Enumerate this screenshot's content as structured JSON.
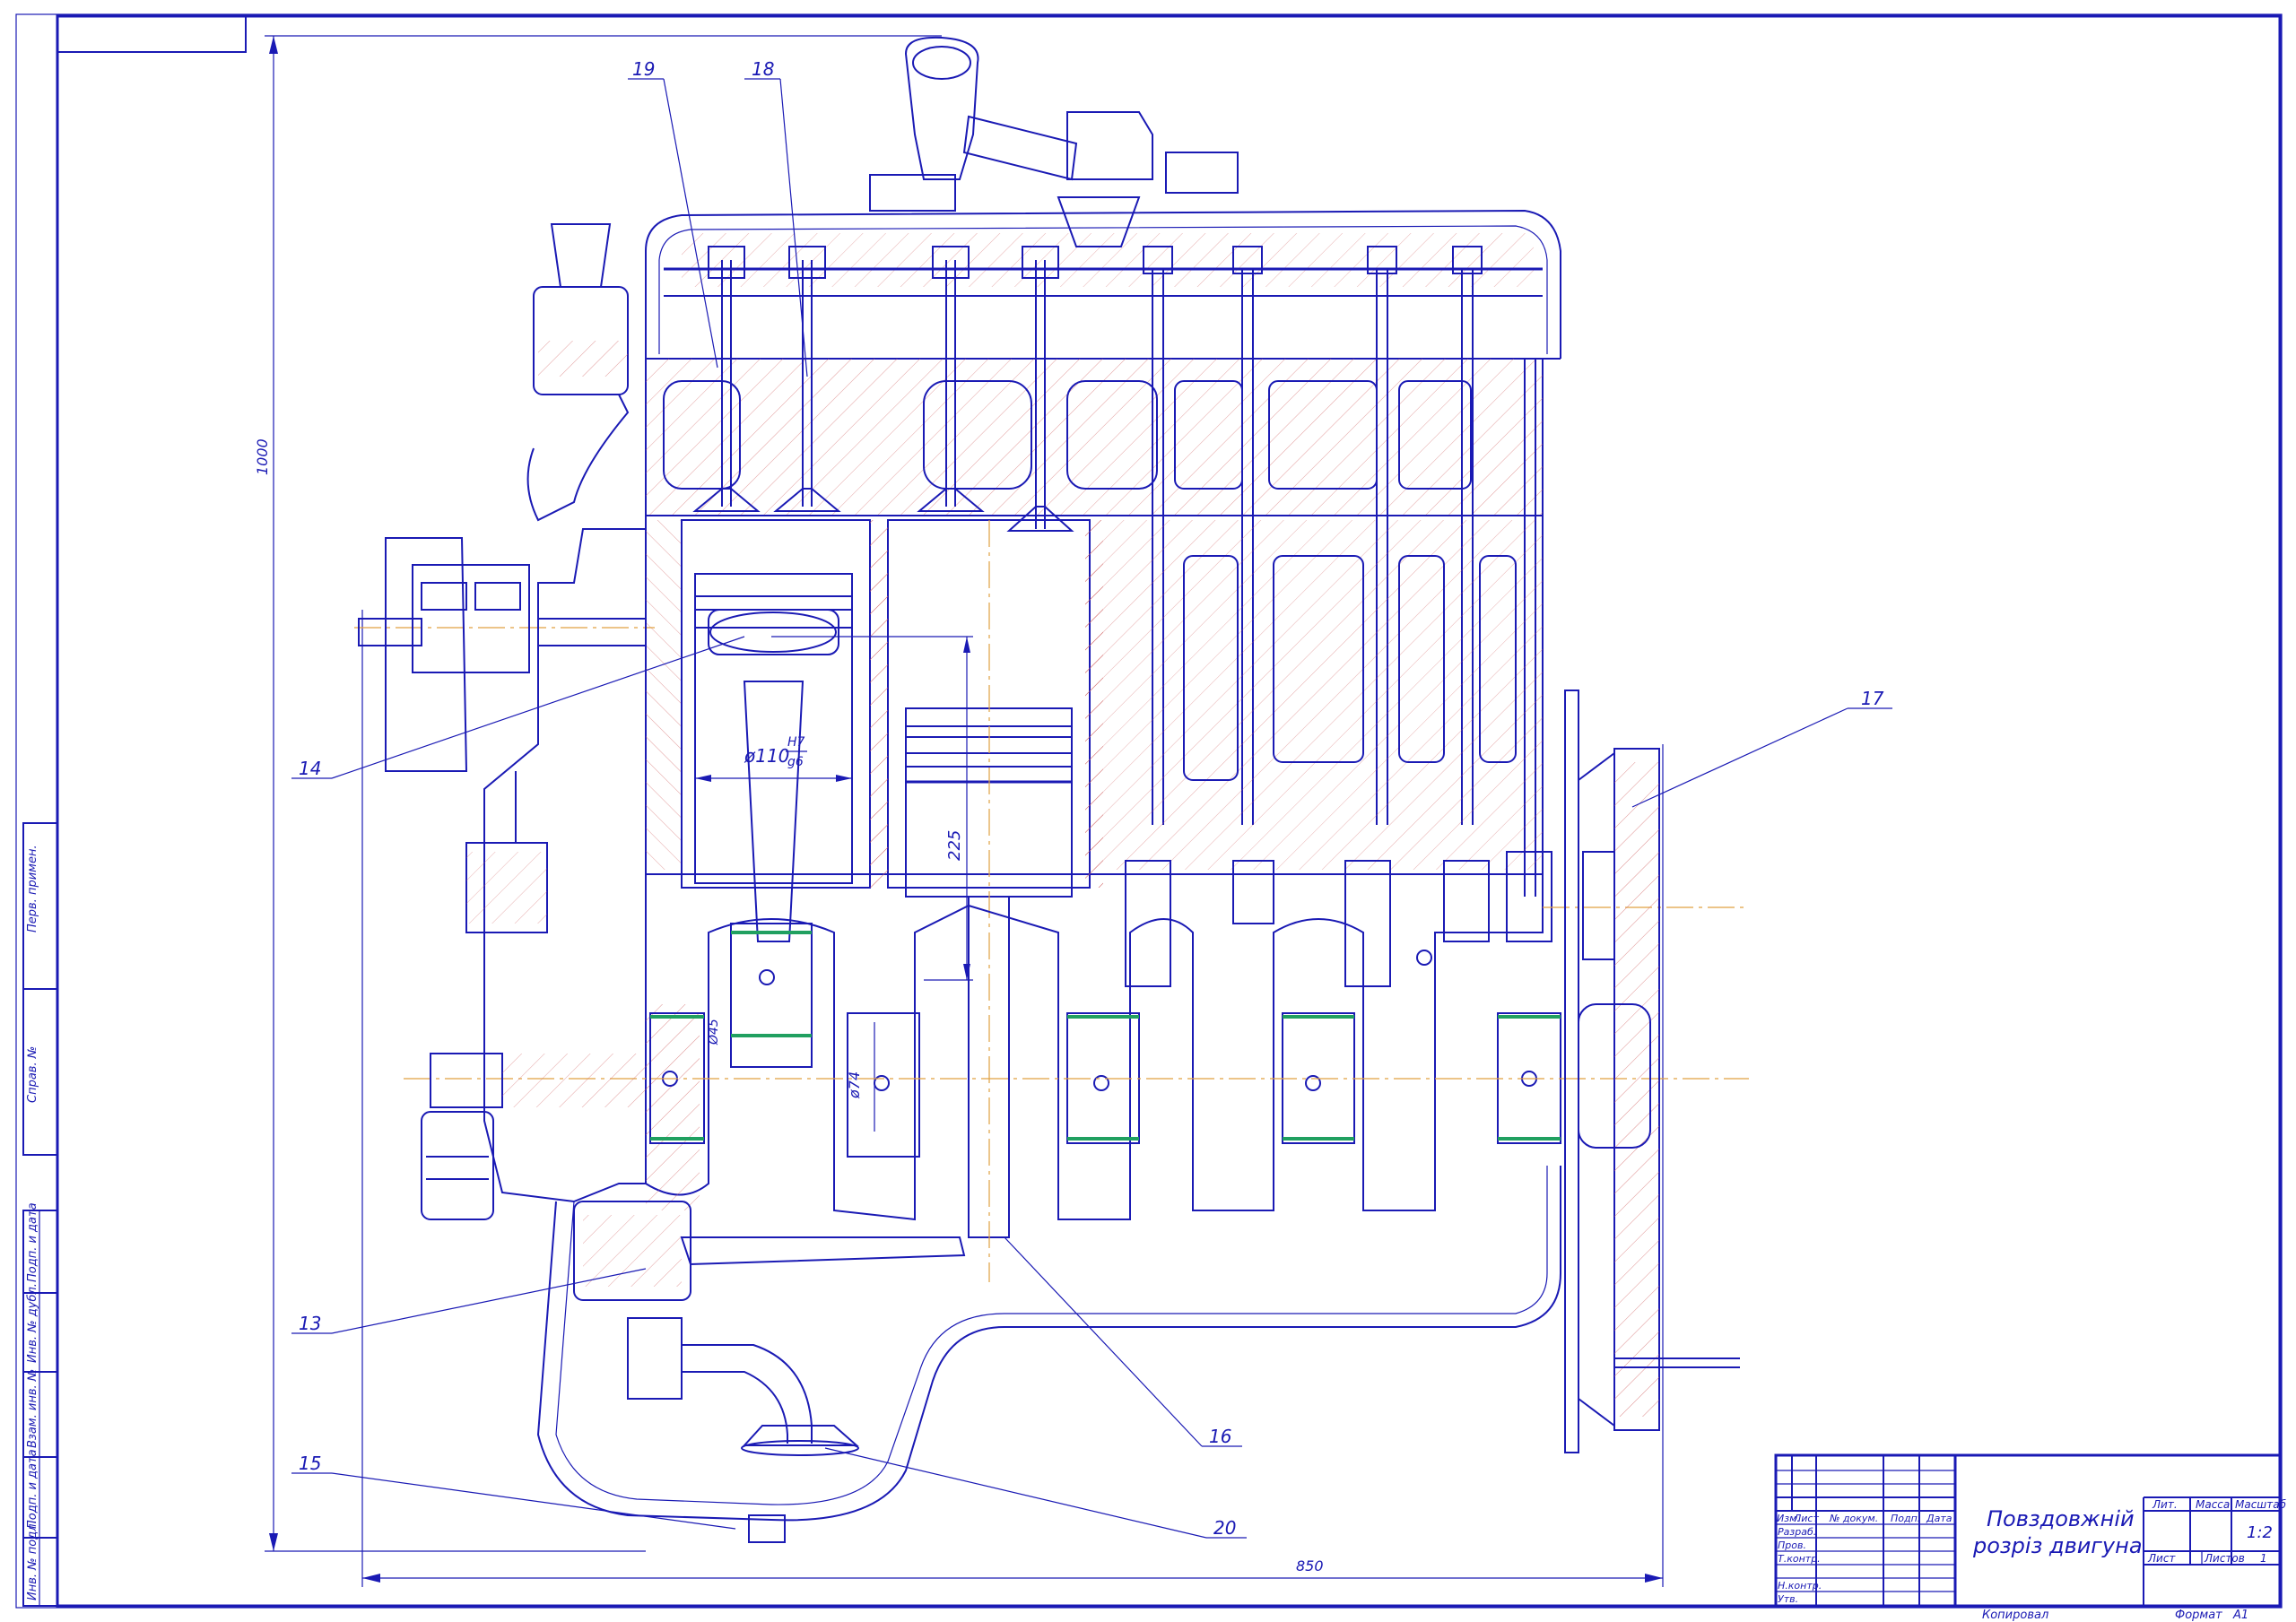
{
  "drawing": {
    "overall_height_dim": "1000",
    "overall_width_dim": "850",
    "dims": {
      "bore": "ø110",
      "fit_upper": "H7",
      "fit_lower": "g6",
      "stroke": "225",
      "journal": "ø74",
      "pin": "Ø45"
    },
    "callouts": [
      "19",
      "18",
      "17",
      "14",
      "13",
      "15",
      "16",
      "20"
    ]
  },
  "left_strip": {
    "labels": [
      "Перв. примен.",
      "Справ. №",
      "Подп. и дата",
      "Инв. № дубл.",
      "Взам. инв. №",
      "Подп. и дата",
      "Инв. № подл."
    ]
  },
  "title_block": {
    "title_line1": "Повздовжній",
    "title_line2": "розріз двигуна",
    "col_headers": [
      "Изм.",
      "Лист",
      "№ докум.",
      "Подп.",
      "Дата"
    ],
    "row_labels": [
      "Разраб.",
      "Пров.",
      "Т.контр.",
      "",
      "Н.контр.",
      "Утв."
    ],
    "lit_label": "Лит.",
    "mass_label": "Масса",
    "scale_label": "Масштаб",
    "scale_value": "1:2",
    "sheet_label": "Лист",
    "sheets_label": "Листов",
    "sheets_value": "1",
    "copied_label": "Копировал",
    "format_label": "Формат",
    "format_value": "А1"
  }
}
